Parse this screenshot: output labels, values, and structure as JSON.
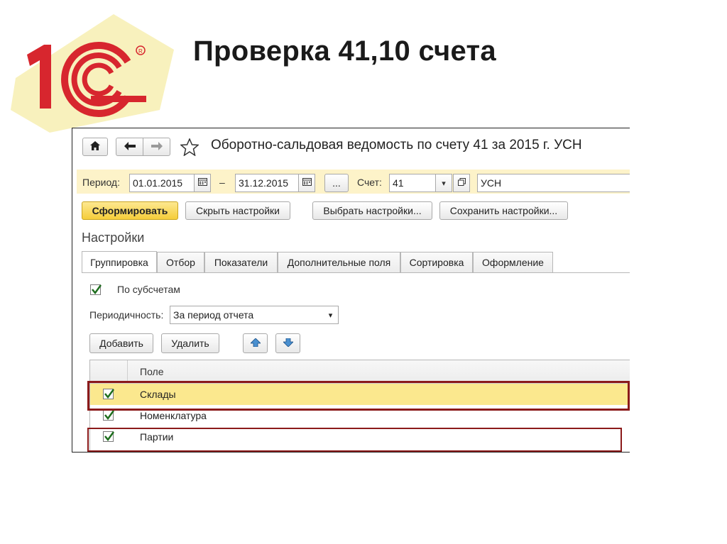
{
  "slide": {
    "title": "Проверка 41,10 счета"
  },
  "colors": {
    "logo_red": "#d7262e",
    "logo_yellow": "#f7efb2",
    "primary_button": "#f5cd3a",
    "period_bar": "#fdf3c9",
    "highlight_frame": "#8b1a1a",
    "selected_row": "#fbe88e"
  },
  "window": {
    "title": "Оборотно-сальдовая ведомость по счету 41 за 2015 г. УСН",
    "icons": [
      "home-icon",
      "back-arrow-icon",
      "forward-arrow-icon",
      "favorite-star-icon"
    ]
  },
  "period": {
    "label": "Период:",
    "from": "01.01.2015",
    "dash": "–",
    "to": "31.12.2015",
    "more_label": "...",
    "account_label": "Счет:",
    "account_value": "41",
    "org_value": "УСН"
  },
  "toolbar": {
    "generate": "Сформировать",
    "hide_settings": "Скрыть настройки",
    "choose_settings": "Выбрать настройки...",
    "save_settings": "Сохранить настройки..."
  },
  "settings": {
    "heading": "Настройки",
    "tabs": [
      {
        "label": "Группировка",
        "active": true
      },
      {
        "label": "Отбор",
        "active": false
      },
      {
        "label": "Показатели",
        "active": false
      },
      {
        "label": "Дополнительные поля",
        "active": false
      },
      {
        "label": "Сортировка",
        "active": false
      },
      {
        "label": "Оформление",
        "active": false
      }
    ],
    "by_subaccounts": {
      "label": "По субсчетам",
      "checked": true
    },
    "periodicity": {
      "label": "Периодичность:",
      "value": "За период отчета"
    },
    "add_button": "Добавить",
    "delete_button": "Удалить"
  },
  "grid": {
    "column_header": "Поле",
    "rows": [
      {
        "label": "Склады",
        "checked": true,
        "selected": true
      },
      {
        "label": "Номенклатура",
        "checked": true,
        "selected": false
      },
      {
        "label": "Партии",
        "checked": true,
        "selected": false
      }
    ]
  }
}
